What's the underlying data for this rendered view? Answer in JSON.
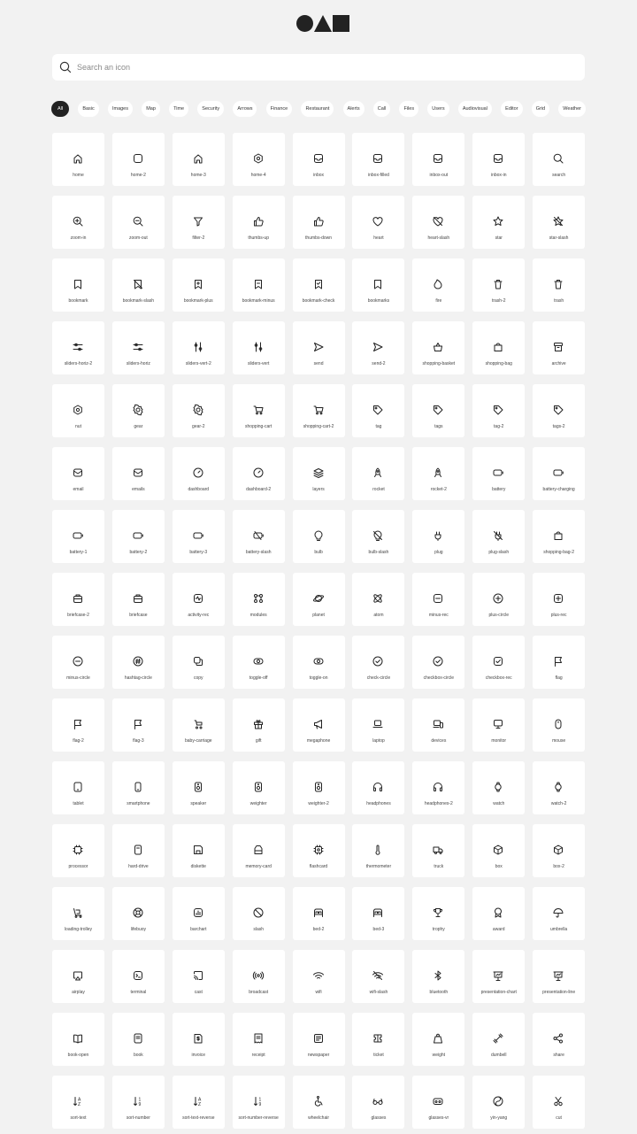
{
  "search": {
    "placeholder": "Search an icon",
    "value": ""
  },
  "tabs": [
    {
      "label": "All",
      "active": true
    },
    {
      "label": "Basic"
    },
    {
      "label": "Images"
    },
    {
      "label": "Map"
    },
    {
      "label": "Time"
    },
    {
      "label": "Security"
    },
    {
      "label": "Arrows"
    },
    {
      "label": "Finance"
    },
    {
      "label": "Restaurant"
    },
    {
      "label": "Alerts"
    },
    {
      "label": "Call"
    },
    {
      "label": "Files"
    },
    {
      "label": "Users"
    },
    {
      "label": "Audiovisual"
    },
    {
      "label": "Editor"
    },
    {
      "label": "Grid"
    },
    {
      "label": "Weather"
    }
  ],
  "icons": [
    "home",
    "home-2",
    "home-3",
    "home-4",
    "inbox",
    "inbox-filled",
    "inbox-out",
    "inbox-in",
    "search",
    "zoom-in",
    "zoom-out",
    "filter-2",
    "thumbs-up",
    "thumbs-down",
    "heart",
    "heart-slash",
    "star",
    "star-slash",
    "bookmark",
    "bookmark-slash",
    "bookmark-plus",
    "bookmark-minus",
    "bookmark-check",
    "bookmarks",
    "fire",
    "trash-2",
    "trash",
    "sliders-horiz-2",
    "sliders-horiz",
    "sliders-vert-2",
    "sliders-vert",
    "send",
    "send-2",
    "shopping-basket",
    "shopping-bag",
    "archive",
    "nut",
    "gear",
    "gear-2",
    "shopping-cart",
    "shopping-cart-2",
    "tag",
    "tags",
    "tag-2",
    "tags-2",
    "email",
    "emails",
    "dashboard",
    "dashboard-2",
    "layers",
    "rocket",
    "rocket-2",
    "battery",
    "battery-charging",
    "battery-1",
    "battery-2",
    "battery-3",
    "battery-slash",
    "bulb",
    "bulb-slash",
    "plug",
    "plug-slash",
    "shopping-bag-2",
    "briefcase-2",
    "briefcase",
    "activity-rec",
    "modules",
    "planet",
    "atom",
    "minus-rec",
    "plus-circle",
    "plus-rec",
    "minus-circle",
    "hashtag-circle",
    "copy",
    "toggle-off",
    "toggle-on",
    "check-circle",
    "checkbox-circle",
    "checkbox-rec",
    "flag",
    "flag-2",
    "flag-3",
    "baby-carriage",
    "gift",
    "megaphone",
    "laptop",
    "devices",
    "monitor",
    "mouse",
    "tablet",
    "smartphone",
    "speaker",
    "weighter",
    "weighter-2",
    "headphones",
    "headphones-2",
    "watch",
    "watch-2",
    "processor",
    "hard-drive",
    "diskette",
    "memory-card",
    "flashcard",
    "thermometer",
    "truck",
    "box",
    "box-2",
    "loading-trolley",
    "lifebuoy",
    "barchart",
    "slash",
    "bed-2",
    "bed-3",
    "trophy",
    "award",
    "umbrella",
    "airplay",
    "terminal",
    "cast",
    "broadcast",
    "wifi",
    "wifi-slash",
    "bluetooth",
    "presentation-chart",
    "presentation-line",
    "book-open",
    "book",
    "invoice",
    "receipt",
    "newspaper",
    "ticket",
    "weight",
    "dumbell",
    "share",
    "sort-text",
    "sort-number",
    "sort-text-reverse",
    "sort-number-reverse",
    "wheelchair",
    "glasses",
    "glasses-vr",
    "yin-yang",
    "cut"
  ]
}
